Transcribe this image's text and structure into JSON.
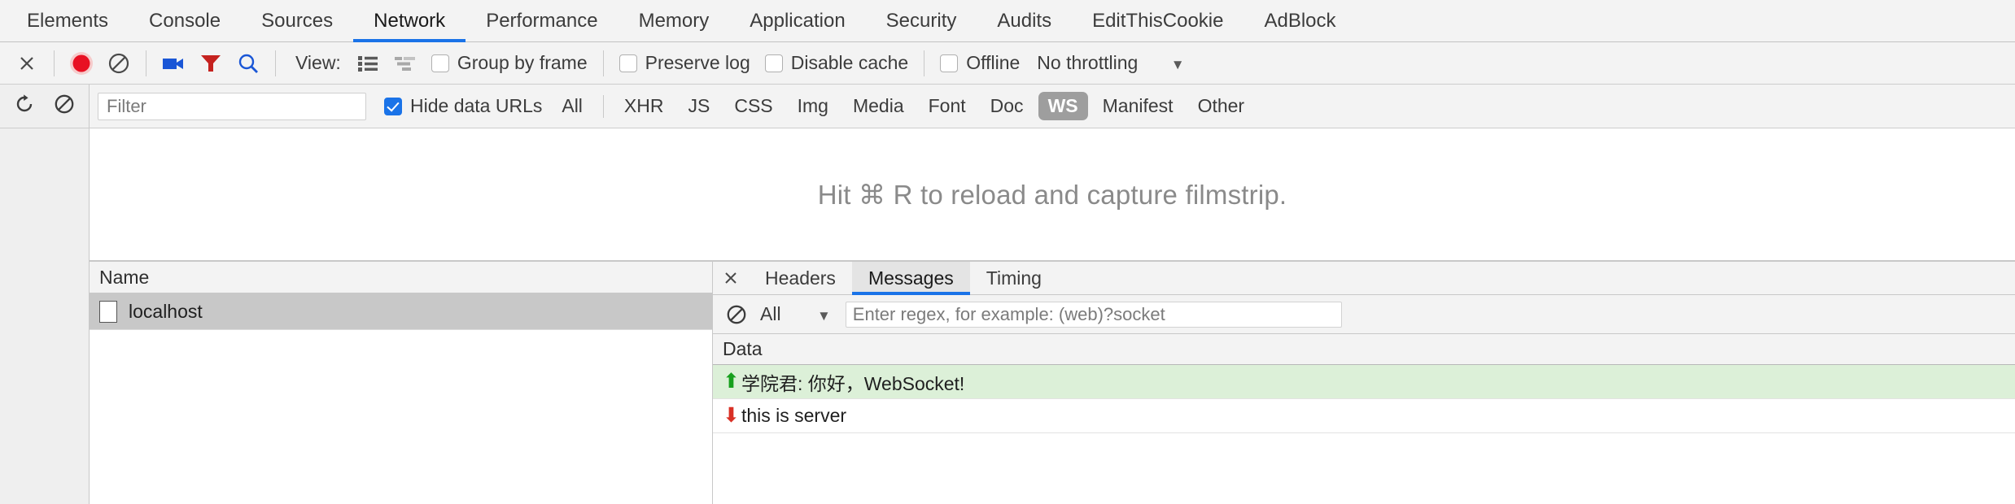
{
  "panel_tabs": [
    {
      "label": "Elements",
      "active": false
    },
    {
      "label": "Console",
      "active": false
    },
    {
      "label": "Sources",
      "active": false
    },
    {
      "label": "Network",
      "active": true
    },
    {
      "label": "Performance",
      "active": false
    },
    {
      "label": "Memory",
      "active": false
    },
    {
      "label": "Application",
      "active": false
    },
    {
      "label": "Security",
      "active": false
    },
    {
      "label": "Audits",
      "active": false
    },
    {
      "label": "EditThisCookie",
      "active": false
    },
    {
      "label": "AdBlock",
      "active": false
    }
  ],
  "toolbar": {
    "close_icon": "close-icon",
    "record_icon": "record-icon",
    "clear_icon": "clear-icon",
    "camera_icon": "camera-icon",
    "filter_icon": "filter-funnel-icon",
    "search_icon": "search-icon",
    "view_label": "View:",
    "list_view_icon": "list-view-icon",
    "waterfall_view_icon": "waterfall-view-icon",
    "group_by_frame": "Group by frame",
    "preserve_log": "Preserve log",
    "disable_cache": "Disable cache",
    "offline": "Offline",
    "throttling": "No throttling",
    "caret": "▼",
    "colors": {
      "record": "#e81123",
      "camera": "#1a56d6",
      "funnel": "#c5221f",
      "search": "#1a56d6",
      "accent": "#1a73e8"
    }
  },
  "filter_row": {
    "reload_icon": "reload-icon",
    "clear_icon": "clear-icon",
    "filter_placeholder": "Filter",
    "filter_value": "",
    "hide_data_urls": "Hide data URLs",
    "hide_data_urls_checked": true,
    "types": [
      {
        "label": "All",
        "selected": false
      },
      {
        "label": "XHR",
        "selected": false
      },
      {
        "label": "JS",
        "selected": false
      },
      {
        "label": "CSS",
        "selected": false
      },
      {
        "label": "Img",
        "selected": false
      },
      {
        "label": "Media",
        "selected": false
      },
      {
        "label": "Font",
        "selected": false
      },
      {
        "label": "Doc",
        "selected": false
      },
      {
        "label": "WS",
        "selected": true
      },
      {
        "label": "Manifest",
        "selected": false
      },
      {
        "label": "Other",
        "selected": false
      }
    ]
  },
  "filmstrip": {
    "hint": "Hit ⌘ R to reload and capture filmstrip."
  },
  "requests": {
    "column_header": "Name",
    "rows": [
      {
        "name": "localhost",
        "icon": "document-icon",
        "selected": true
      }
    ]
  },
  "detail": {
    "close_icon": "close-icon",
    "tabs": [
      {
        "label": "Headers",
        "active": false
      },
      {
        "label": "Messages",
        "active": true
      },
      {
        "label": "Timing",
        "active": false
      }
    ],
    "message_filter": {
      "clear_icon": "clear-icon",
      "selected_type": "All",
      "caret": "▼",
      "regex_placeholder": "Enter regex, for example: (web)?socket",
      "regex_value": ""
    },
    "messages": {
      "column_header": "Data",
      "rows": [
        {
          "direction": "sent",
          "arrow": "⬆",
          "text": "学院君: 你好，WebSocket!"
        },
        {
          "direction": "received",
          "arrow": "⬇",
          "text": "this is server"
        }
      ]
    }
  }
}
